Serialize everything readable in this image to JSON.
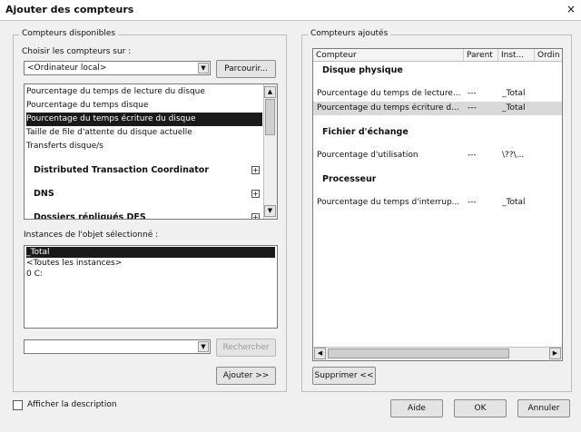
{
  "window": {
    "title": "Ajouter des compteurs",
    "close_glyph": "×"
  },
  "left_group": {
    "legend": "Compteurs disponibles",
    "choose_label": "Choisir les compteurs sur :",
    "computer_combo_value": "<Ordinateur local>",
    "browse_button": "Parcourir...",
    "counters": [
      {
        "label": "Pourcentage du temps de lecture du disque",
        "selected": false,
        "bold": false
      },
      {
        "label": "Pourcentage du temps disque",
        "selected": false,
        "bold": false
      },
      {
        "label": "Pourcentage du temps écriture du disque",
        "selected": true,
        "bold": false
      },
      {
        "label": "Taille de file d'attente du disque actuelle",
        "selected": false,
        "bold": false
      },
      {
        "label": "Transferts disque/s",
        "selected": false,
        "bold": false
      },
      {
        "label": "Distributed Transaction Coordinator",
        "selected": false,
        "bold": true
      },
      {
        "label": "DNS",
        "selected": false,
        "bold": true
      },
      {
        "label": "Dossiers répliqués DFS",
        "selected": false,
        "bold": true
      }
    ],
    "instances_label": "Instances de l'objet sélectionné :",
    "instances": [
      {
        "label": "_Total",
        "selected": true
      },
      {
        "label": "<Toutes les instances>",
        "selected": false
      },
      {
        "label": "0 C:",
        "selected": false
      }
    ],
    "search_combo_value": "",
    "search_button": "Rechercher",
    "add_button": "Ajouter >>"
  },
  "right_group": {
    "legend": "Compteurs ajoutés",
    "columns": [
      "Compteur",
      "Parent",
      "Inst...",
      "Ordin"
    ],
    "groups": [
      {
        "name": "Disque physique",
        "rows": [
          {
            "counter": "Pourcentage du temps de lecture...",
            "parent": "---",
            "instance": "_Total",
            "selected": false
          },
          {
            "counter": "Pourcentage du temps écriture d...",
            "parent": "---",
            "instance": "_Total",
            "selected": true
          }
        ]
      },
      {
        "name": "Fichier d'échange",
        "rows": [
          {
            "counter": "Pourcentage d'utilisation",
            "parent": "---",
            "instance": "\\??\\...",
            "selected": false
          }
        ]
      },
      {
        "name": "Processeur",
        "rows": [
          {
            "counter": "Pourcentage du temps d'interrup...",
            "parent": "---",
            "instance": "_Total",
            "selected": false
          }
        ]
      }
    ],
    "remove_button": "Supprimer <<"
  },
  "footer": {
    "show_description_label": "Afficher la description",
    "show_description_checked": false,
    "help_button": "Aide",
    "ok_button": "OK",
    "cancel_button": "Annuler"
  }
}
